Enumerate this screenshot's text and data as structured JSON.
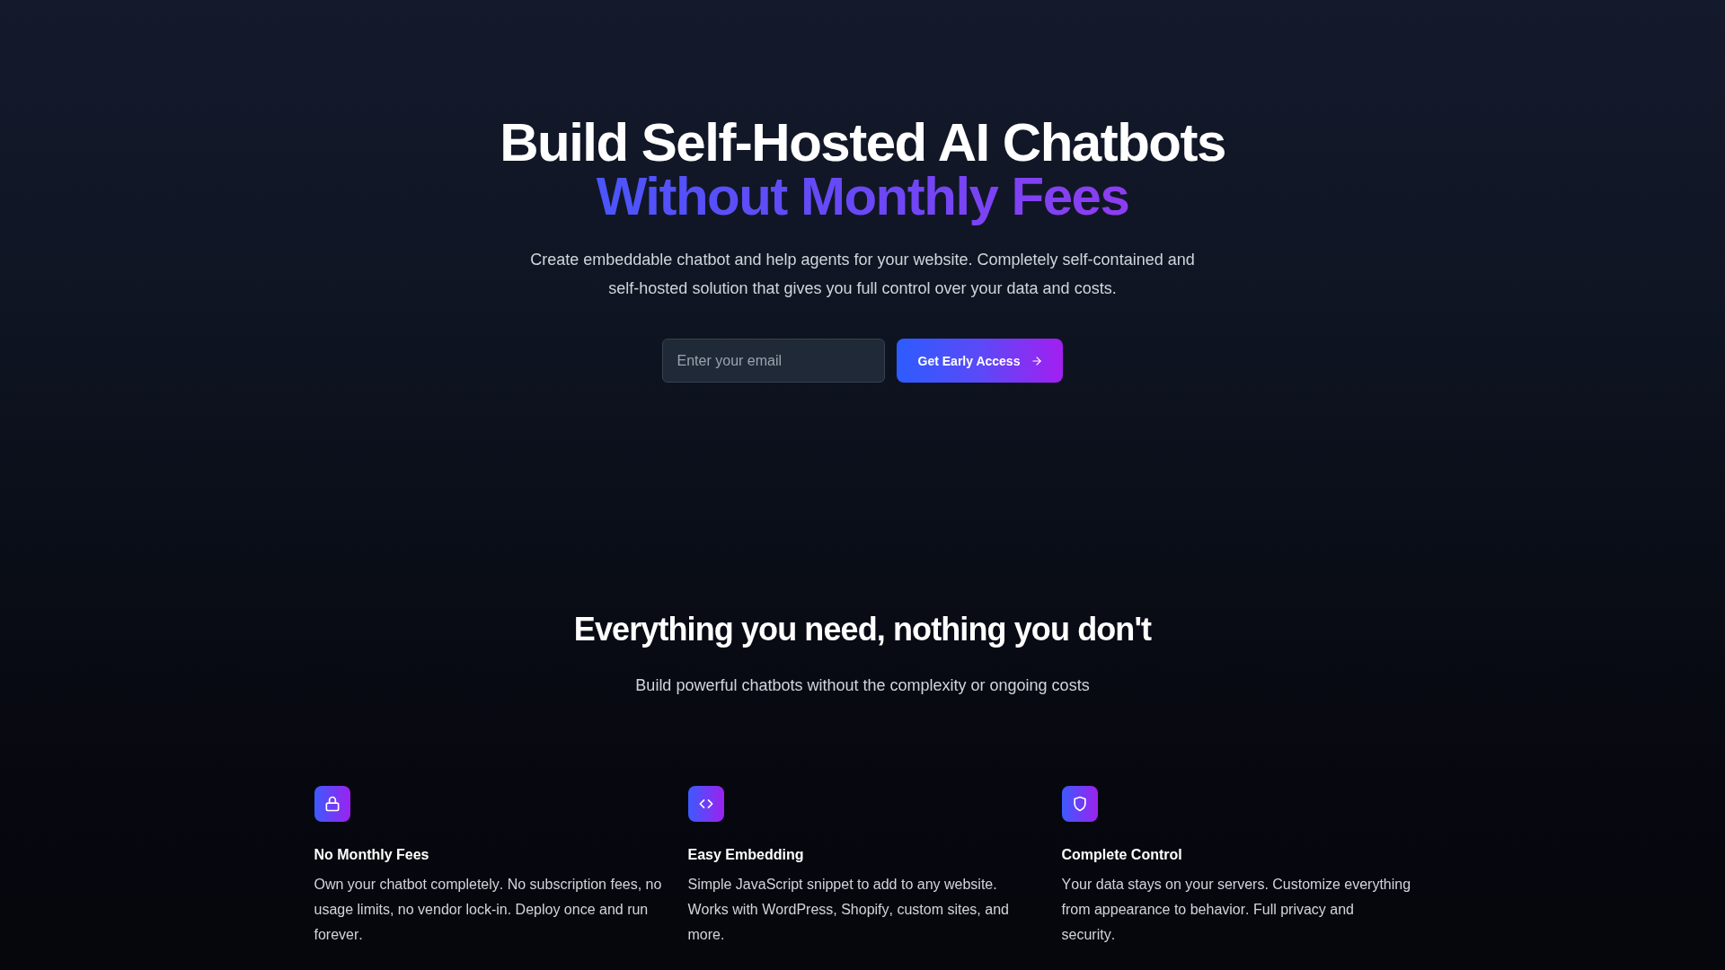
{
  "hero": {
    "title": "Build Self-Hosted AI Chatbots",
    "title_highlight": "Without Monthly Fees",
    "subtitle": "Create embeddable chatbot and help agents for your website. Completely self-contained and self-hosted solution that gives you full control over your data and costs.",
    "email_field": {
      "placeholder": "Enter your email"
    },
    "button": {
      "label": "Get Early Access"
    }
  },
  "features": {
    "heading": "Everything you need, nothing you don't",
    "subheading": "Build powerful chatbots without the complexity or ongoing costs",
    "items": [
      {
        "title": "No Monthly Fees",
        "description": "Own your chatbot completely. No subscription fees, no usage limits, no vendor lock-in. Deploy once and run forever."
      },
      {
        "title": "Easy Embedding",
        "description": "Simple JavaScript snippet to add to any website. Works with WordPress, Shopify, custom sites, and more."
      },
      {
        "title": "Complete Control",
        "description": "Your data stays on your servers. Customize everything from appearance to behavior. Full privacy and security."
      }
    ]
  }
}
